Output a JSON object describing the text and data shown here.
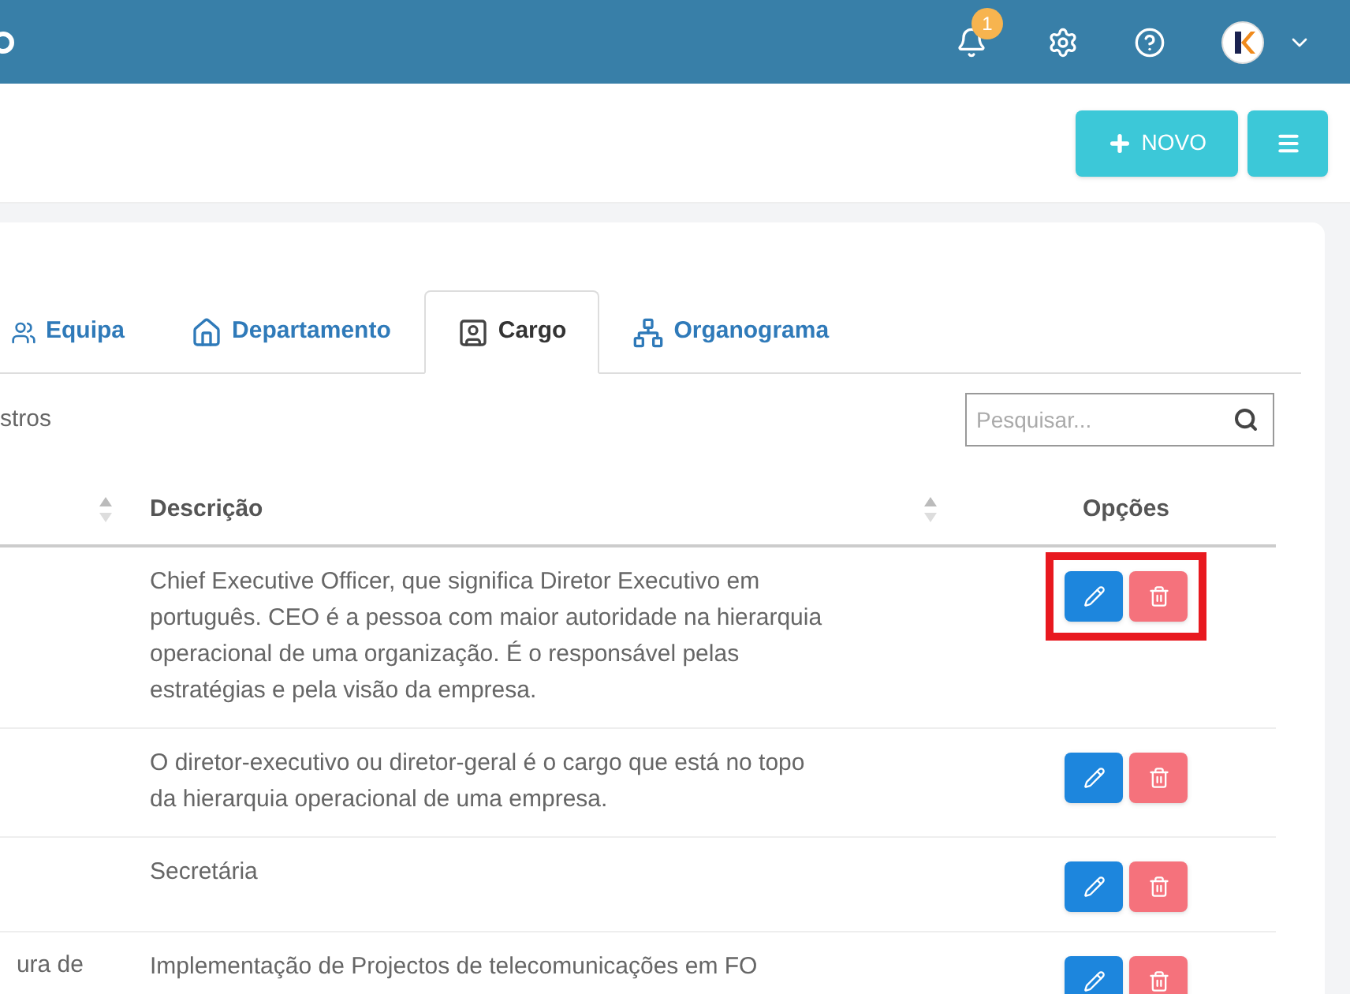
{
  "header": {
    "notifications": {
      "count": "1"
    }
  },
  "toolbar": {
    "buttons": [
      {
        "kind": "new",
        "label": "NOVO"
      },
      {
        "kind": "menu"
      }
    ]
  },
  "tabs": [
    {
      "kind": "team",
      "label": "Equipa",
      "selected": false
    },
    {
      "kind": "department",
      "label": "Departamento",
      "selected": false
    },
    {
      "kind": "role",
      "label": "Cargo",
      "selected": true
    },
    {
      "kind": "orgchart",
      "label": "Organograma",
      "selected": false
    }
  ],
  "records_text": "stros",
  "search": {
    "placeholder": "Pesquisar..."
  },
  "table": {
    "columns": [
      {
        "sortable": true
      },
      {
        "label": "Descrição",
        "sortable": true
      },
      {
        "label": "Opções",
        "sortable": false
      }
    ],
    "rows": [
      {
        "description": "Chief Executive Officer, que significa Diretor Executivo em português. CEO é a pessoa com maior autoridade na hierarquia operacional de uma organização. É o responsável pelas estratégias e pela visão da empresa.",
        "highlighted": true
      },
      {
        "description": "O diretor-executivo ou diretor-geral é o cargo que está no topo da hierarquia operacional de uma empresa.",
        "highlighted": false
      },
      {
        "description": "Secretária",
        "highlighted": false
      },
      {
        "column_1": "ura de",
        "description": "Implementação de Projectos de telecomunicações em FO",
        "highlighted": false
      }
    ]
  }
}
